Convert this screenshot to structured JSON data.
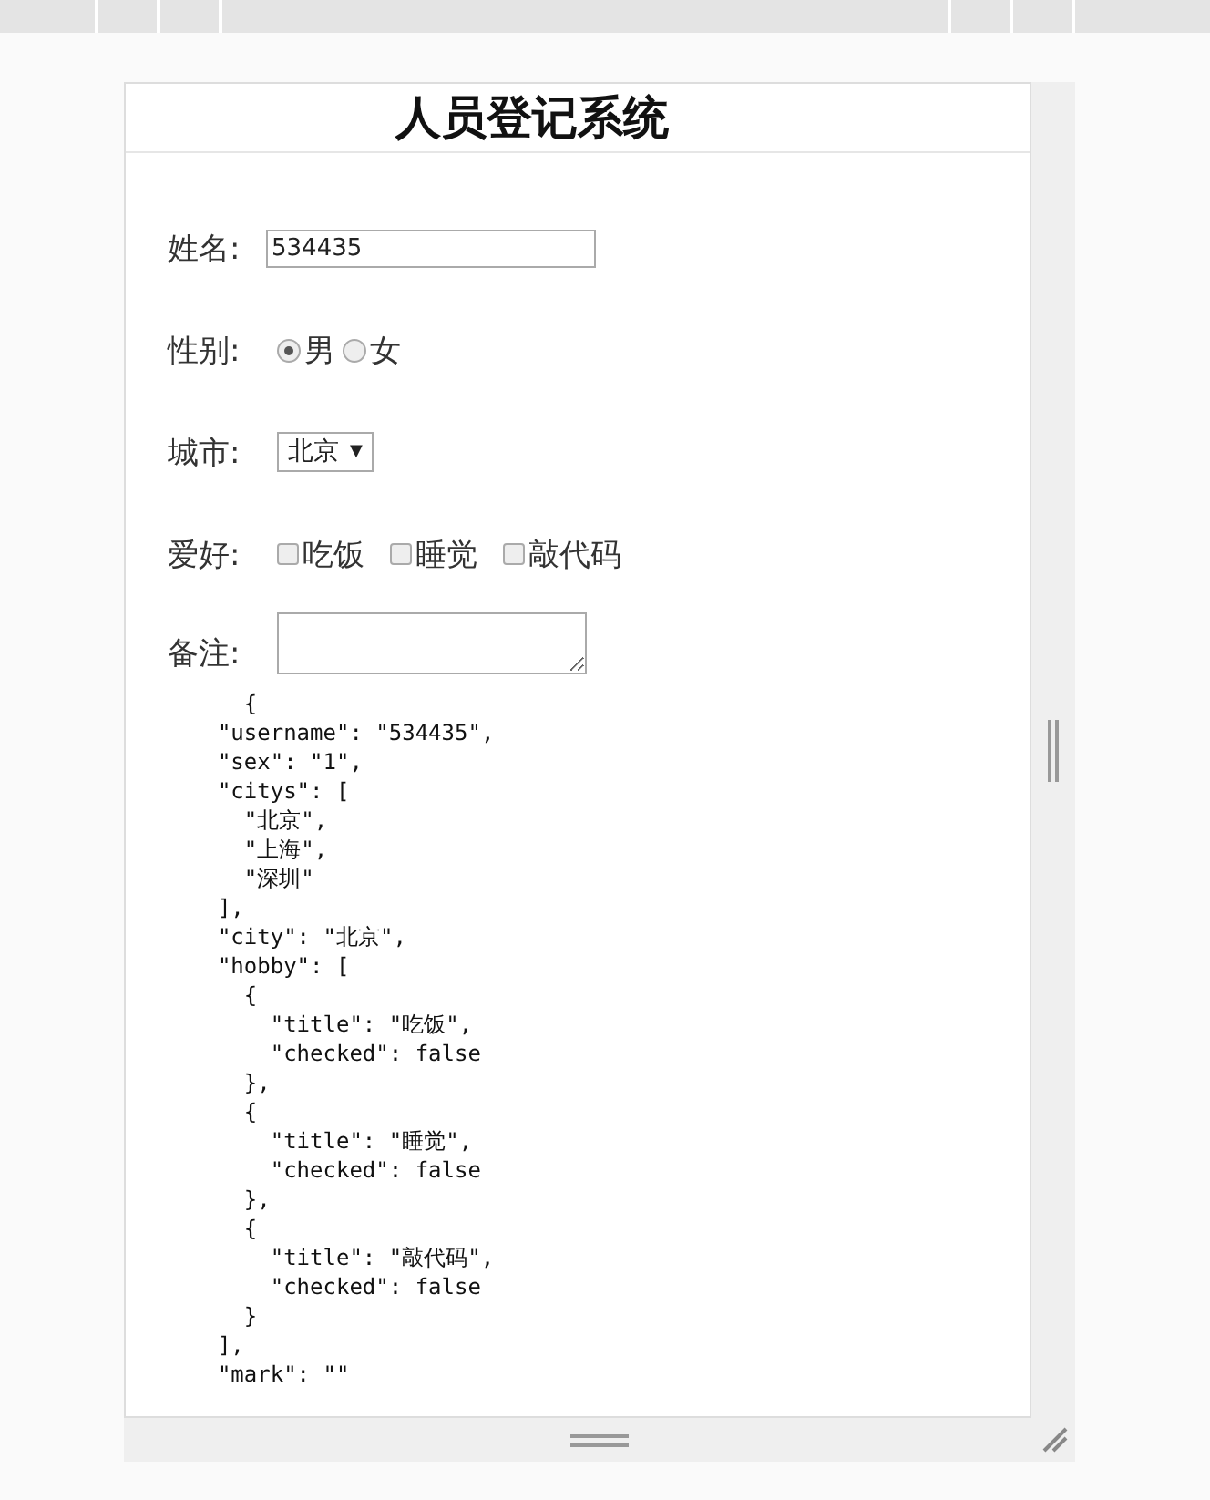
{
  "title": "人员登记系统",
  "form": {
    "name": {
      "label": "姓名:",
      "value": "534435"
    },
    "sex": {
      "label": "性别:",
      "options": [
        {
          "label": "男",
          "selected": true
        },
        {
          "label": "女",
          "selected": false
        }
      ]
    },
    "city": {
      "label": "城市:",
      "value": "北京",
      "caret": "▼"
    },
    "hobby": {
      "label": "爱好:",
      "items": [
        {
          "label": "吃饭",
          "checked": false
        },
        {
          "label": "睡觉",
          "checked": false
        },
        {
          "label": "敲代码",
          "checked": false
        }
      ]
    },
    "remark": {
      "label": "备注:"
    }
  },
  "json_preview": [
    "    {",
    "  \"username\": \"534435\",",
    "  \"sex\": \"1\",",
    "  \"citys\": [",
    "    \"北京\",",
    "    \"上海\",",
    "    \"深圳\"",
    "  ],",
    "  \"city\": \"北京\",",
    "  \"hobby\": [",
    "    {",
    "      \"title\": \"吃饭\",",
    "      \"checked\": false",
    "    },",
    "    {",
    "      \"title\": \"睡觉\",",
    "      \"checked\": false",
    "    },",
    "    {",
    "      \"title\": \"敲代码\",",
    "      \"checked\": false",
    "    }",
    "  ],",
    "  \"mark\": \"\""
  ]
}
